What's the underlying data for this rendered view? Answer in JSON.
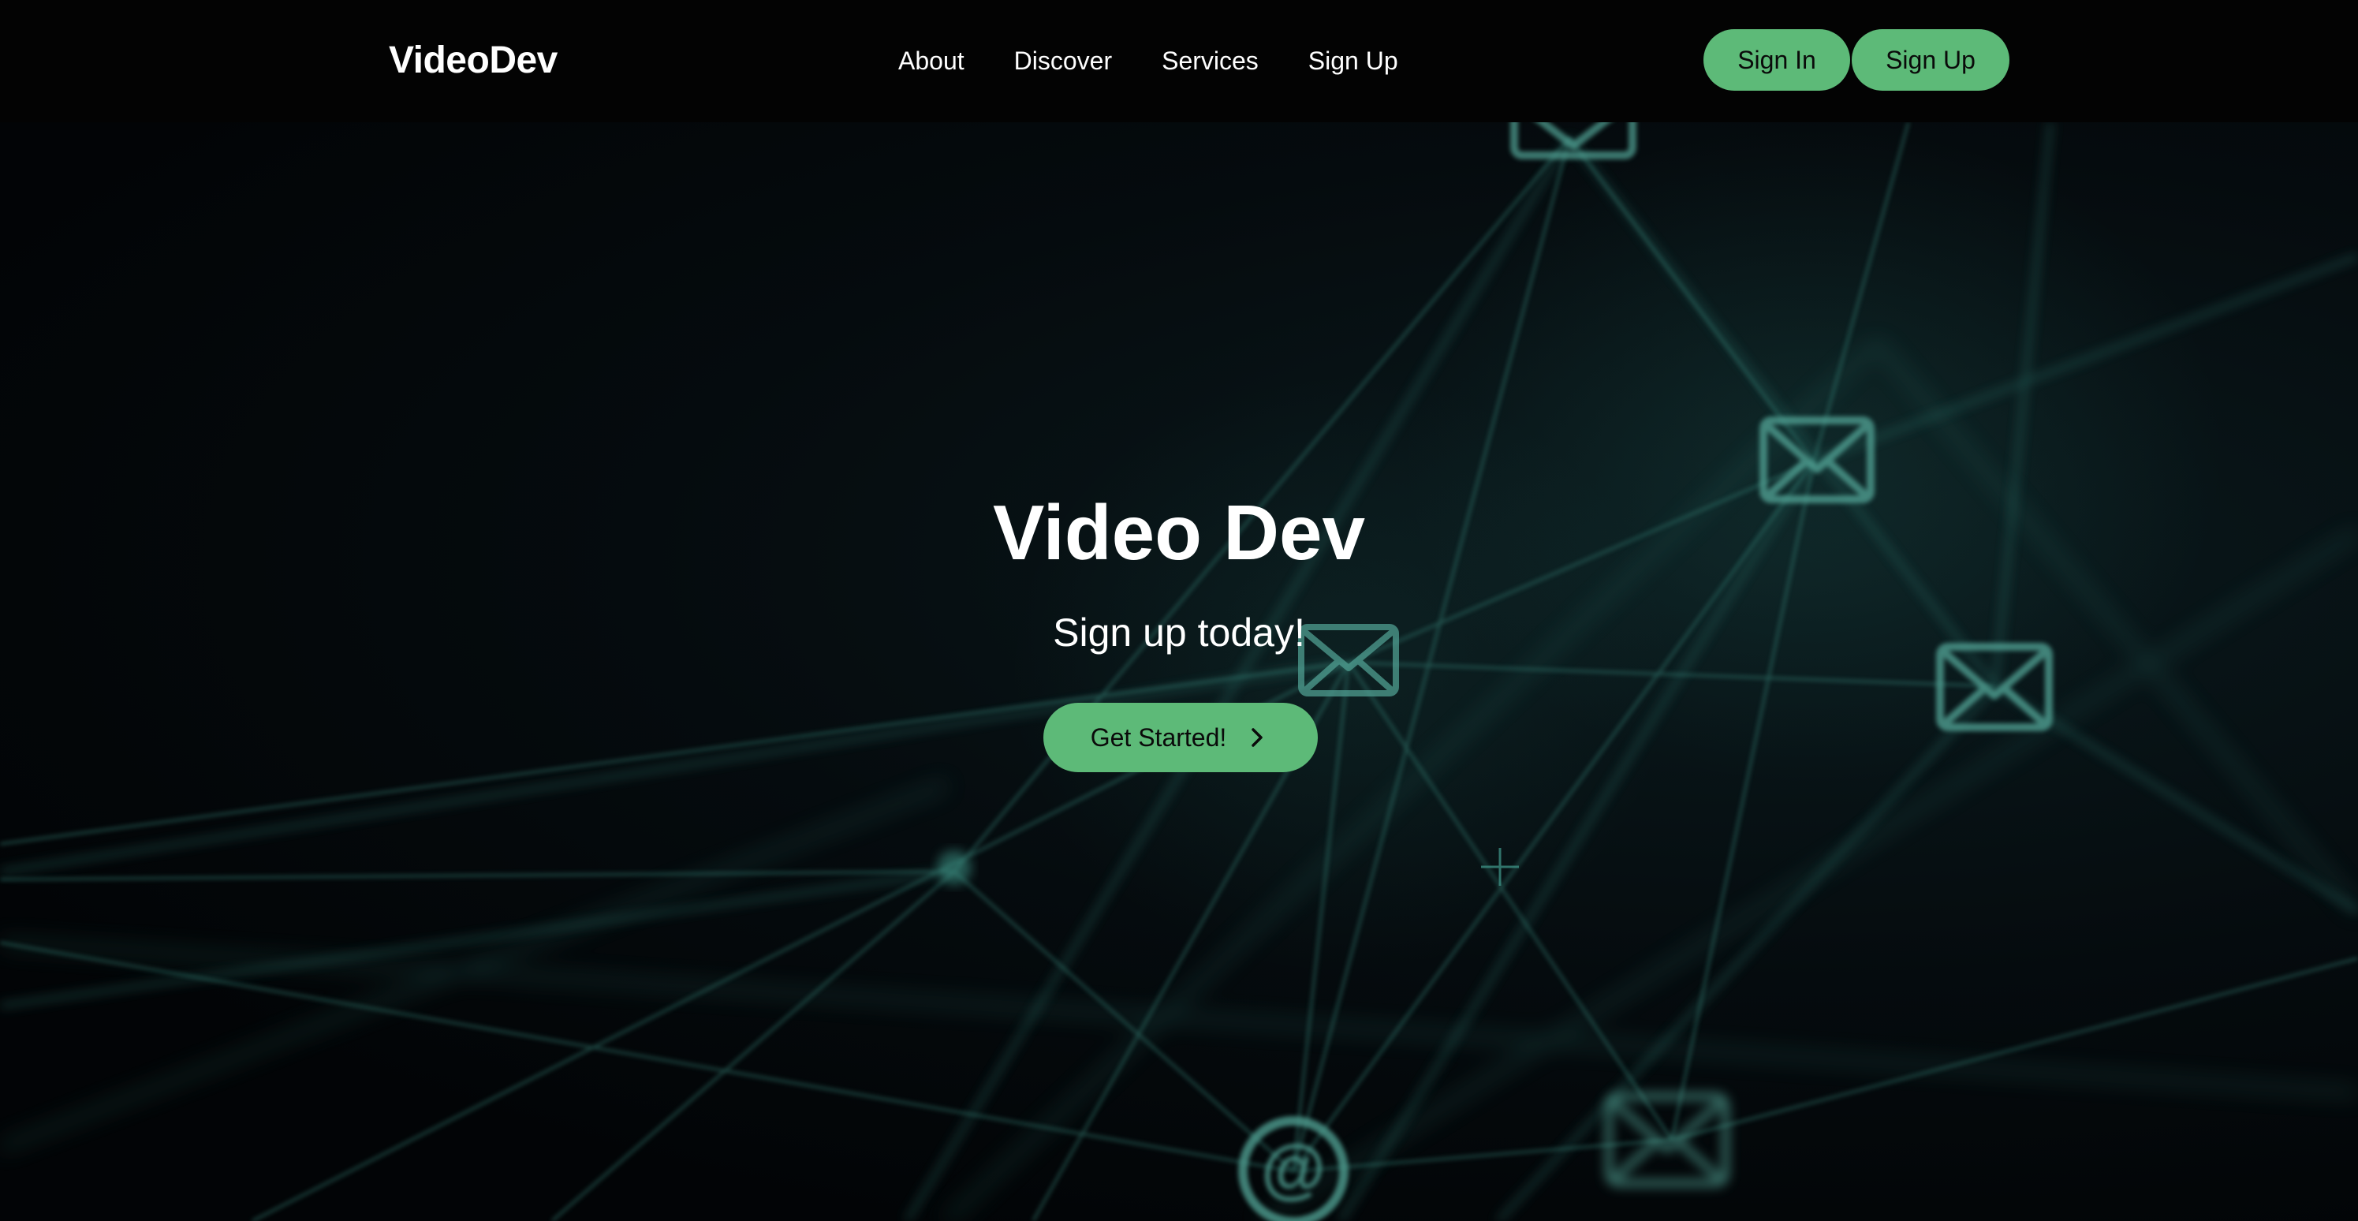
{
  "nav": {
    "brand": "VideoDev",
    "links": [
      "About",
      "Discover",
      "Services",
      "Sign Up"
    ],
    "sign_in": "Sign In",
    "sign_up": "Sign Up"
  },
  "hero": {
    "title": "Video Dev",
    "subtitle": "Sign up today!",
    "cta": "Get Started!",
    "cta_icon": "chevron-right-icon",
    "background": "network-of-mail-icons"
  },
  "colors": {
    "accent": "#5dba78",
    "nav_bg": "#030303",
    "hero_bg": "#020406",
    "network_line": "#2f7d73",
    "text": "#ffffff"
  }
}
